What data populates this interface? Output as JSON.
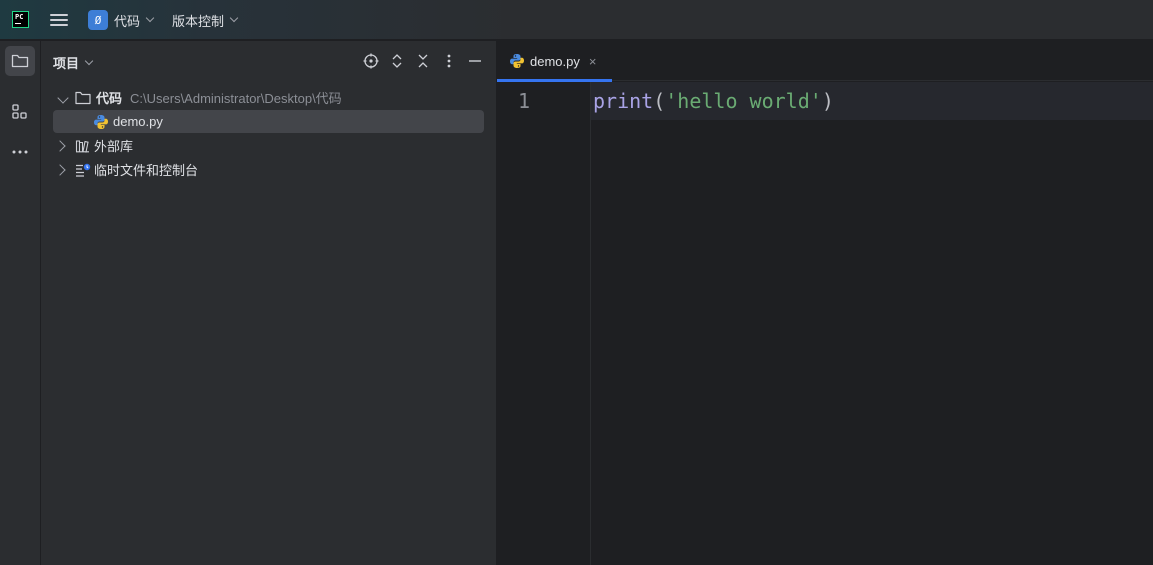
{
  "titlebar": {
    "logo_text": "PC",
    "logo_icon": "pycharm-logo",
    "menu_icon": "hamburger-menu-icon",
    "project": {
      "badge": "Ø",
      "name": "代码"
    },
    "vcs": {
      "label": "版本控制"
    }
  },
  "toolstrip": {
    "items": [
      {
        "name": "project-tool",
        "icon": "folder-icon",
        "active": true
      },
      {
        "name": "structure-tool",
        "icon": "structure-icon",
        "active": false
      },
      {
        "name": "more-tools",
        "icon": "more-icon",
        "active": false
      }
    ]
  },
  "project_panel": {
    "title": "项目",
    "header_icons": [
      "locate-icon",
      "expand-all-icon",
      "collapse-all-icon",
      "options-icon",
      "hide-icon"
    ],
    "tree": [
      {
        "label": "代码",
        "path": "C:\\Users\\Administrator\\Desktop\\代码",
        "icon": "folder-icon",
        "expanded": true
      },
      {
        "label": "demo.py",
        "icon": "python-file-icon",
        "selected": true
      },
      {
        "label": "外部库",
        "icon": "library-icon",
        "expanded": false
      },
      {
        "label": "临时文件和控制台",
        "icon": "scratches-icon",
        "expanded": false
      }
    ]
  },
  "editor": {
    "tab": {
      "label": "demo.py",
      "close": "×",
      "icon": "python-file-icon"
    },
    "line_number": "1",
    "code": {
      "fn": "print",
      "open": "(",
      "str": "'hello world'",
      "close": ")"
    }
  },
  "colors": {
    "accent": "#3574f0",
    "background": "#1e1f22",
    "panel": "#2b2d30",
    "selection": "#43454a",
    "string": "#6aab73",
    "function": "#a9a3e6"
  }
}
